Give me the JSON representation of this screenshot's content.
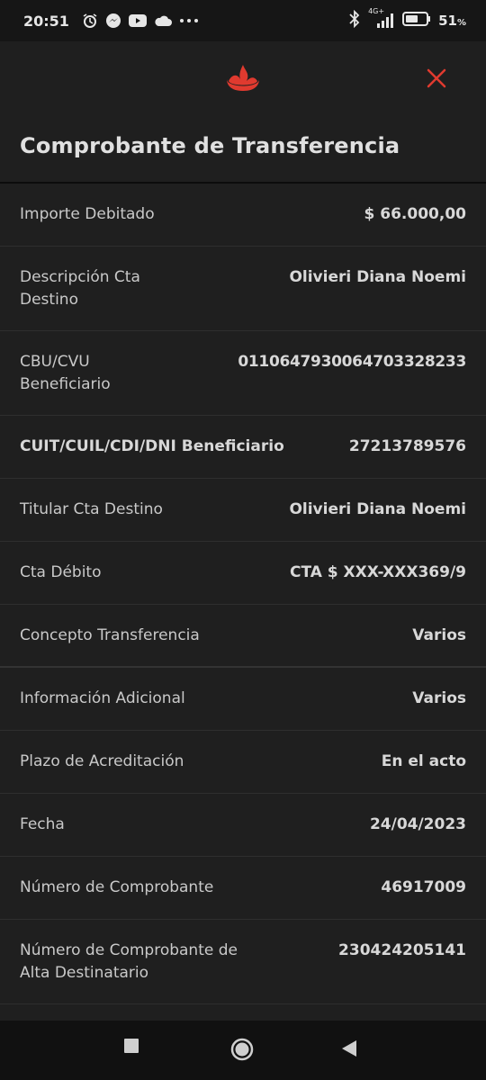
{
  "status_bar": {
    "time": "20:51",
    "network": "4G+",
    "battery": "51",
    "battery_unit": "%"
  },
  "header": {
    "title": "Comprobante de Transferencia",
    "logo_icon": "santander-flame-icon",
    "close_icon": "close-icon",
    "accent_color": "#e03a2f"
  },
  "details": [
    {
      "label": "Importe Debitado",
      "value": "$ 66.000,00"
    },
    {
      "label": "Descripción Cta Destino",
      "value": "Olivieri Diana Noemi"
    },
    {
      "label": "CBU/CVU Beneficiario",
      "value": "0110647930064703328233"
    },
    {
      "label": "CUIT/CUIL/CDI/DNI Beneficiario",
      "value": "27213789576"
    },
    {
      "label": "Titular Cta Destino",
      "value": "Olivieri Diana Noemi"
    },
    {
      "label": "Cta Débito",
      "value": "CTA $ XXX-XXX369/9"
    },
    {
      "label": "Concepto Transferencia",
      "value": "Varios"
    },
    {
      "label": "Información Adicional",
      "value": "Varios"
    },
    {
      "label": "Plazo de Acreditación",
      "value": "En el acto"
    },
    {
      "label": "Fecha",
      "value": "24/04/2023"
    },
    {
      "label": "Número de Comprobante",
      "value": "46917009"
    },
    {
      "label": "Número de Comprobante de Alta Destinatario",
      "value": "230424205141"
    }
  ],
  "nav": {
    "recents_icon": "square-recents-icon",
    "home_icon": "circle-home-icon",
    "back_icon": "triangle-back-icon"
  }
}
